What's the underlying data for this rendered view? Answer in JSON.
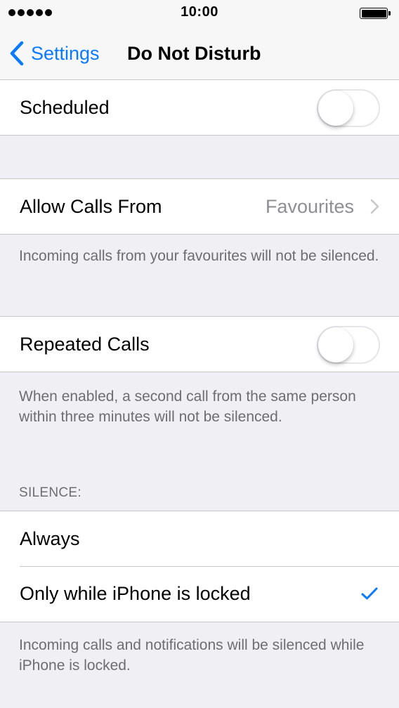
{
  "status_bar": {
    "time": "10:00",
    "signal_icon": "signal-dots-icon",
    "battery_icon": "battery-full-icon"
  },
  "nav": {
    "back_label": "Settings",
    "back_icon": "chevron-left-icon",
    "title": "Do Not Disturb",
    "accent_color": "#0a7aff"
  },
  "scheduled": {
    "label": "Scheduled",
    "toggle_on": false
  },
  "allow_calls": {
    "label": "Allow Calls From",
    "value": "Favourites",
    "footer": "Incoming calls from your favourites will not be silenced."
  },
  "repeated_calls": {
    "label": "Repeated Calls",
    "toggle_on": false,
    "footer": "When enabled, a second call from the same person within three minutes will not be silenced."
  },
  "silence": {
    "header": "SILENCE:",
    "options": [
      {
        "label": "Always",
        "selected": false
      },
      {
        "label": "Only while iPhone is locked",
        "selected": true
      }
    ],
    "footer": "Incoming calls and notifications will be silenced while iPhone is locked."
  }
}
